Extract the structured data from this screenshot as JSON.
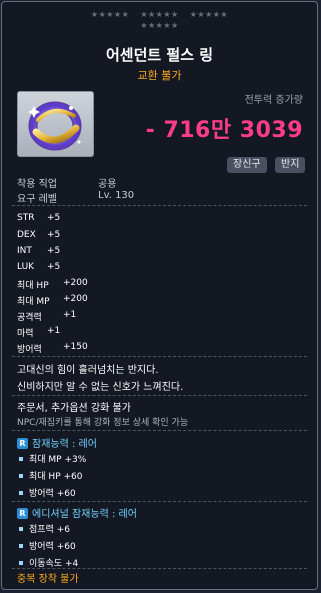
{
  "stars_rows": [
    [
      "★★★★★",
      "★★★★★",
      "★★★★★"
    ],
    [
      "★★★★★"
    ]
  ],
  "item": {
    "name": "어센던트 펄스 링",
    "trade": "교환 불가",
    "icon_name": "ring-icon"
  },
  "combat_power": {
    "label": "전투력 증가량",
    "value": "- 716만 3039"
  },
  "tags": [
    "장신구",
    "반지"
  ],
  "requirements": [
    {
      "label": "착용 직업",
      "value": "공용"
    },
    {
      "label": "요구 레벨",
      "value": "Lv. 130"
    }
  ],
  "stats": [
    {
      "key": "STR",
      "value": "+5"
    },
    {
      "key": "DEX",
      "value": "+5"
    },
    {
      "key": "INT",
      "value": "+5"
    },
    {
      "key": "LUK",
      "value": "+5"
    },
    {
      "key": "최대 HP",
      "value": "+200"
    },
    {
      "key": "최대 MP",
      "value": "+200"
    },
    {
      "key": "공격력",
      "value": "+1"
    },
    {
      "key": "마력",
      "value": "+1"
    },
    {
      "key": "방어력",
      "value": "+150"
    }
  ],
  "description": [
    "고대신의 힘이 흘러넘치는 반지다.",
    "신비하지만 알 수 없는 신호가 느껴진다."
  ],
  "enhance": {
    "line": "주문서, 추가옵션 강화 불가",
    "note": "NPC/재집키를 통해 강화 정보 상세 확인 가능"
  },
  "potential": {
    "header": "잠재능력 : 레어",
    "badge": "R",
    "lines": [
      "최대 MP +3%",
      "최대 HP +60",
      "방어력 +60"
    ]
  },
  "additional_potential": {
    "header": "에디셔널 잠재능력 : 레어",
    "badge": "R",
    "lines": [
      "점프력 +6",
      "방어력 +60",
      "이동속도 +4"
    ]
  },
  "footer": "중복 장착 불가",
  "colors": {
    "title": "#ffffff",
    "trade": "#ffaa22",
    "combat": "#ff3d86",
    "potential": "#6fd2ff"
  }
}
